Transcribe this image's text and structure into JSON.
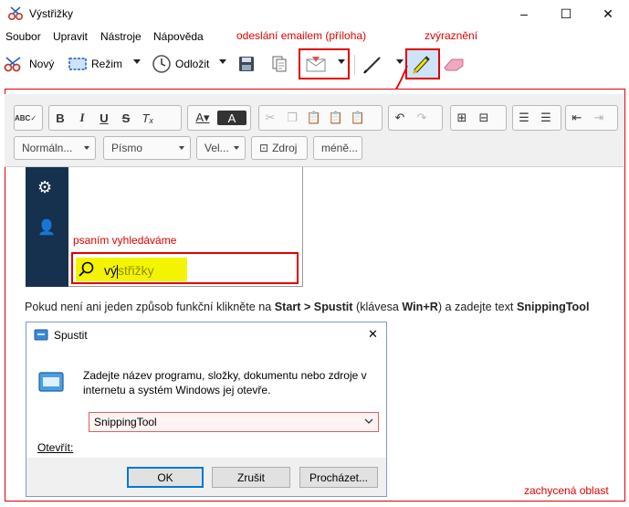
{
  "window": {
    "title": "Výstřižky",
    "minimize": "–",
    "maximize": "☐",
    "close": "✕"
  },
  "menu": [
    "Soubor",
    "Upravit",
    "Nástroje",
    "Nápověda"
  ],
  "annotations": {
    "email": "odeslání emailem (příloha)",
    "highlight": "zvýraznění",
    "typing": "psaním vyhledáváme",
    "area": "zachycená oblast"
  },
  "toolbar": {
    "new_label": "Nový",
    "mode_label": "Režim",
    "delay_label": "Odložit"
  },
  "editor": {
    "combos": [
      "Normáln...",
      "Písmo",
      "Vel...",
      "Zdroj",
      "méně..."
    ]
  },
  "search": {
    "typed": "vý",
    "rest": "střižky"
  },
  "paragraph": {
    "t1": "Pokud není ani jeden způsob funkční klikněte na ",
    "b1": "Start > Spustit",
    "t2": " (klávesa ",
    "b2": "Win+R",
    "t3": ") a zadejte text ",
    "b3": "SnippingTool"
  },
  "run": {
    "title": "Spustit",
    "description": "Zadejte název programu, složky, dokumentu nebo zdroje v internetu a systém Windows jej otevře.",
    "open_label": "Otevřít:",
    "value": "SnippingTool",
    "ok": "OK",
    "cancel": "Zrušit",
    "browse": "Procházet..."
  },
  "colors": {
    "annotation_red": "#e00000",
    "highlight_yellow": "#f4f400",
    "sidebar_navy": "#15314e"
  }
}
